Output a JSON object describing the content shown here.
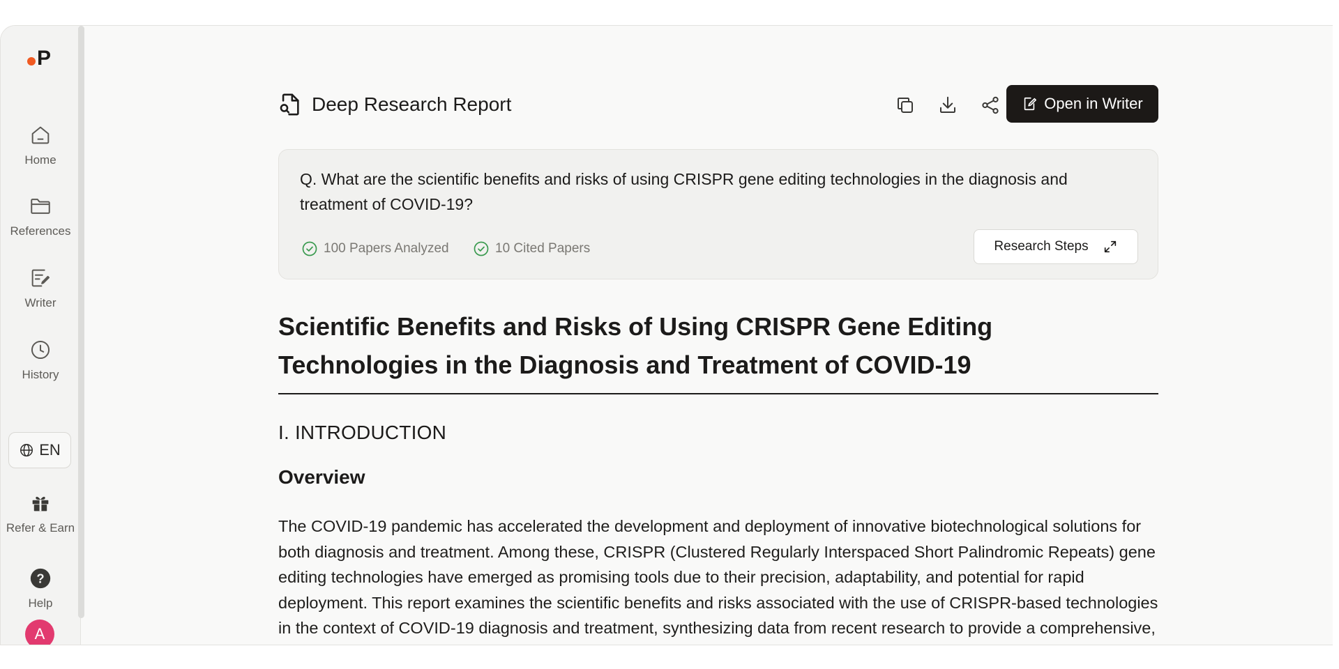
{
  "sidebar": {
    "logo_letter": "P",
    "items": [
      {
        "label": "Home",
        "icon": "home-icon"
      },
      {
        "label": "References",
        "icon": "folder-icon"
      },
      {
        "label": "Writer",
        "icon": "writer-icon"
      },
      {
        "label": "History",
        "icon": "clock-icon"
      },
      {
        "label": "Refer & Earn",
        "icon": "gift-icon"
      },
      {
        "label": "Help",
        "icon": "help-icon"
      }
    ],
    "language": "EN",
    "avatar_initial": "A"
  },
  "header": {
    "title": "Deep Research Report",
    "icon": "research-report-icon",
    "actions": {
      "copy_icon": "copy-icon",
      "download_icon": "download-icon",
      "share_icon": "share-icon",
      "open_writer_label": "Open in Writer"
    }
  },
  "question": {
    "text": "Q. What are the scientific benefits and risks of using CRISPR gene editing technologies in the diagnosis and treatment of COVID-19?",
    "stats": [
      {
        "label": "100 Papers Analyzed",
        "icon": "check-circle-icon"
      },
      {
        "label": "10 Cited Papers",
        "icon": "check-circle-icon"
      }
    ],
    "research_steps_label": "Research Steps"
  },
  "document": {
    "title": "Scientific Benefits and Risks of Using CRISPR Gene Editing Technologies in the Diagnosis and Treatment of COVID-19",
    "section_heading": "I. INTRODUCTION",
    "subheading": "Overview",
    "paragraph": "The COVID-19 pandemic has accelerated the development and deployment of innovative biotechnological solutions for both diagnosis and treatment. Among these, CRISPR (Clustered Regularly Interspaced Short Palindromic Repeats) gene editing technologies have emerged as promising tools due to their precision, adaptability, and potential for rapid deployment. This report examines the scientific benefits and risks associated with the use of CRISPR-based technologies in the context of COVID-19 diagnosis and treatment, synthesizing data from recent research to provide a comprehensive, evidence-based analysis."
  },
  "colors": {
    "brand_dot": "#f05a22",
    "primary_button": "#1c1917",
    "check_green": "#3a9a4f",
    "avatar": "#e23a6f"
  }
}
